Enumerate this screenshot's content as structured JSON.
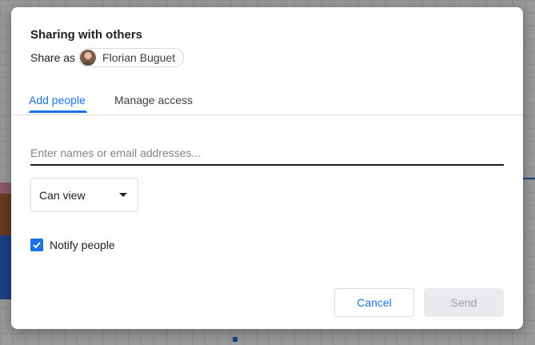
{
  "dialog": {
    "title": "Sharing with others",
    "share_as_label": "Share as",
    "account_name": "Florian Buguet"
  },
  "tabs": [
    {
      "label": "Add people",
      "active": true
    },
    {
      "label": "Manage access",
      "active": false
    }
  ],
  "add_people": {
    "input_value": "",
    "input_placeholder": "Enter names or email addresses...",
    "permission": "Can view",
    "notify_label": "Notify people",
    "notify_checked": true
  },
  "actions": {
    "cancel_label": "Cancel",
    "send_label": "Send",
    "send_enabled": false
  },
  "colors": {
    "accent": "#1a73e8",
    "disabled_bg": "#e8eaed",
    "disabled_text": "#9aa0a6"
  }
}
